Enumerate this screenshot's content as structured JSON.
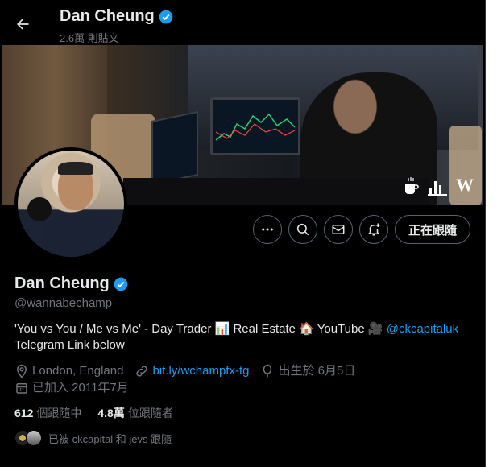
{
  "header": {
    "name": "Dan Cheung",
    "post_count": "2.6萬 則貼文"
  },
  "profile": {
    "name": "Dan Cheung",
    "handle": "@wannabechamp",
    "bio_line1": "'You vs You / Me vs Me' - Day Trader 📊 Real Estate 🏠 YouTube 🎥 ",
    "bio_link": "@ckcapitaluk",
    "bio_line2": "Telegram Link below",
    "location": "London, England",
    "website": "bit.ly/wchampfx-tg",
    "birthday": "出生於 6月5日",
    "joined": "已加入 2011年7月",
    "following_count": "612",
    "following_label": "個跟隨中",
    "followers_count": "4.8萬",
    "followers_label": "位跟隨者",
    "followed_by": "已被 ckcapital 和 jevs 跟隨"
  },
  "actions": {
    "follow_label": "正在跟隨"
  },
  "banner": {
    "logo_w": "W"
  },
  "colors": {
    "background": "#000000",
    "accent": "#1d9bf0",
    "muted": "#71767b",
    "text": "#e7e9ea",
    "verified": "#1d9bf0"
  },
  "icons": [
    "back-arrow-icon",
    "verified-badge-icon",
    "more-icon",
    "search-icon",
    "mail-icon",
    "notification-add-icon",
    "location-icon",
    "link-icon",
    "balloon-icon",
    "calendar-icon"
  ]
}
